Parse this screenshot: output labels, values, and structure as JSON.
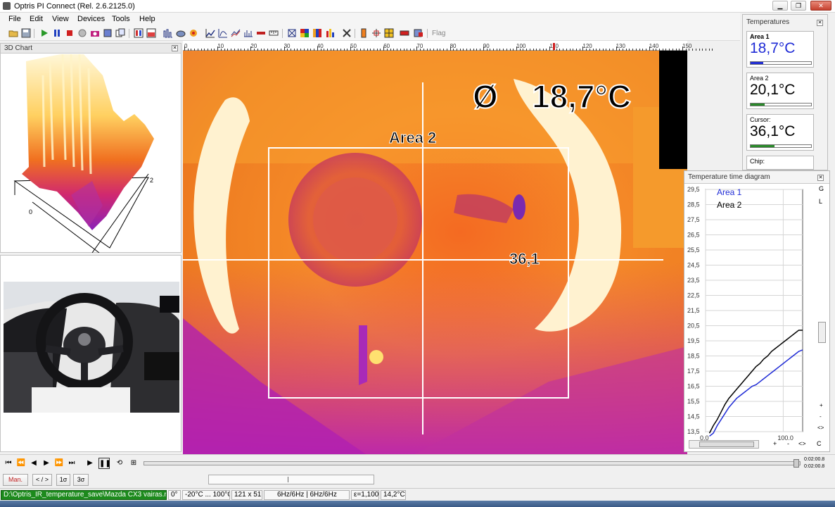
{
  "window": {
    "title": "Optris PI Connect (Rel. 2.6.2125.0)"
  },
  "menu": [
    "File",
    "Edit",
    "View",
    "Devices",
    "Tools",
    "Help"
  ],
  "toolbar": {
    "flag_label": "Flag"
  },
  "panels": {
    "chart3d": {
      "title": "3D Chart",
      "axis_a": "2",
      "axis_b": "0"
    }
  },
  "ruler": {
    "ticks": [
      "0",
      "10",
      "20",
      "30",
      "40",
      "50",
      "60",
      "70",
      "80",
      "90",
      "100",
      "110",
      "120",
      "130",
      "140",
      "150"
    ]
  },
  "thermal": {
    "average_symbol": "Ø",
    "average_value": "18,7°C",
    "area2_label": "Area 2",
    "cursor_value": "36,1"
  },
  "temperatures": {
    "title": "Temperatures",
    "items": [
      {
        "label": "Area 1",
        "value": "18,7°C",
        "color": "#1f2bd6"
      },
      {
        "label": "Area 2",
        "value": "20,1°C",
        "color": "#000000"
      },
      {
        "label": "Cursor:",
        "value": "36,1°C",
        "color": "#000000"
      },
      {
        "label": "Chip:",
        "value": ""
      }
    ]
  },
  "time_diagram": {
    "title": "Temperature time diagram",
    "side_buttons": [
      "G",
      "L",
      "+",
      "-",
      "<>",
      "C"
    ],
    "bottom_buttons": [
      "+",
      "-",
      "<>",
      "C"
    ],
    "chart_data": {
      "type": "line",
      "y_ticks": [
        "29,5",
        "28,5",
        "27,5",
        "26,5",
        "25,5",
        "24,5",
        "23,5",
        "22,5",
        "21,5",
        "20,5",
        "19,5",
        "18,5",
        "17,5",
        "16,5",
        "15,5",
        "14,5",
        "13,5"
      ],
      "x_ticks": [
        "0,0",
        "100,0"
      ],
      "ylim": [
        13.5,
        29.5
      ],
      "xlim": [
        0,
        125
      ],
      "grid": true,
      "legend_position": "top-left",
      "series": [
        {
          "name": "Area 1",
          "color": "#1f2bd6",
          "x": [
            5,
            10,
            15,
            20,
            25,
            30,
            35,
            40,
            45,
            50,
            55,
            60,
            65,
            70,
            75,
            80,
            85,
            90,
            95,
            100,
            105,
            110,
            115,
            120,
            125
          ],
          "y": [
            13.2,
            13.4,
            13.9,
            14.3,
            14.7,
            15.1,
            15.4,
            15.7,
            15.9,
            16.1,
            16.3,
            16.5,
            16.6,
            16.8,
            17.0,
            17.2,
            17.4,
            17.6,
            17.8,
            18.0,
            18.2,
            18.4,
            18.6,
            18.8,
            18.9
          ]
        },
        {
          "name": "Area 2",
          "color": "#000000",
          "x": [
            5,
            10,
            15,
            20,
            25,
            30,
            35,
            40,
            45,
            50,
            55,
            60,
            65,
            70,
            75,
            80,
            85,
            90,
            95,
            100,
            105,
            110,
            115,
            120,
            125
          ],
          "y": [
            13.4,
            13.9,
            14.3,
            14.8,
            15.3,
            15.7,
            16.0,
            16.3,
            16.6,
            16.9,
            17.2,
            17.5,
            17.8,
            18.0,
            18.3,
            18.5,
            18.8,
            19.0,
            19.2,
            19.4,
            19.6,
            19.8,
            20.0,
            20.2,
            20.2
          ]
        }
      ]
    }
  },
  "playback": {
    "time_start": "0:02:00.8",
    "time_end": "0:02:00.8"
  },
  "buttons": {
    "man": "Man.",
    "nav": "< / >",
    "one_sigma": "1σ",
    "three_sigma": "3σ"
  },
  "status": {
    "file": "D:\\Optris_IR_temperature_save\\Mazda CX3 vairas.ravi",
    "angle": "0°",
    "range": "-20°C ... 100°C",
    "resolution": "121 x 51",
    "framerate": "6Hz/6Hz | 6Hz/6Hz",
    "emissivity": "ε=1,100",
    "ambient": "14,2°C"
  }
}
